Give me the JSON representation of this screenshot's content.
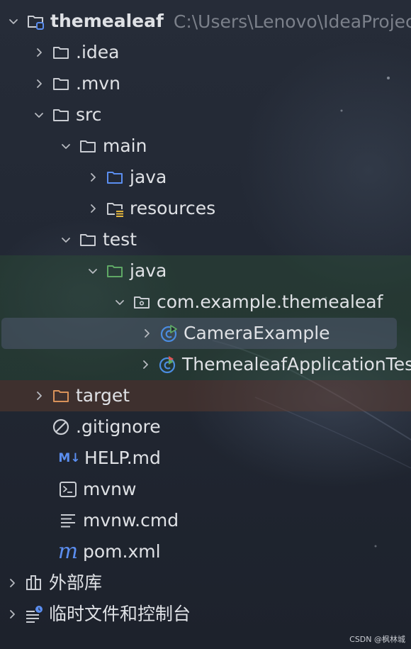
{
  "tree": {
    "project": {
      "name": "themealeaf",
      "path": "C:\\Users\\Lenovo\\IdeaProjects"
    },
    "idea": ".idea",
    "mvn": ".mvn",
    "src": "src",
    "main": "main",
    "main_java": "java",
    "resources": "resources",
    "test": "test",
    "test_java": "java",
    "package": "com.example.themealeaf",
    "camera_example": "CameraExample",
    "app_tests": "ThemealeafApplicationTests",
    "target": "target",
    "gitignore": ".gitignore",
    "help": "HELP.md",
    "mvnw": "mvnw",
    "mvnw_cmd": "mvnw.cmd",
    "pom": "pom.xml",
    "external_libs": "外部库",
    "scratches": "临时文件和控制台"
  },
  "icons": {
    "md_badge": "M↓",
    "maven": "m"
  },
  "colors": {
    "folder": "#c9ccd2",
    "source_root": "#5b8ef0",
    "test_root": "#5fa865",
    "excluded": "#d9925a",
    "class": "#4b8ce0"
  },
  "watermark": "CSDN @枫林城"
}
